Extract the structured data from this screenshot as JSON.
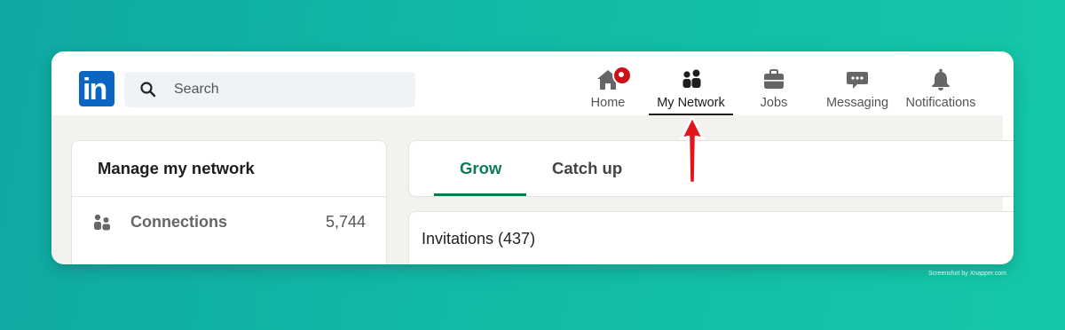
{
  "logo": {
    "text": "in",
    "color": "#0a66c2"
  },
  "search": {
    "placeholder": "Search",
    "icon": "search-icon"
  },
  "nav": {
    "items": [
      {
        "label": "Home",
        "icon": "home-icon",
        "has_badge": true
      },
      {
        "label": "My Network",
        "icon": "my-network-icon",
        "active": true
      },
      {
        "label": "Jobs",
        "icon": "briefcase-icon"
      },
      {
        "label": "Messaging",
        "icon": "chat-icon"
      },
      {
        "label": "Notifications",
        "icon": "bell-icon"
      }
    ]
  },
  "left_panel": {
    "title": "Manage my network",
    "rows": [
      {
        "label": "Connections",
        "count": "5,744",
        "icon": "connections-icon"
      }
    ]
  },
  "tabs": [
    {
      "label": "Grow",
      "active": true
    },
    {
      "label": "Catch up"
    }
  ],
  "invitations": {
    "title": "Invitations (437)"
  },
  "annotation": {
    "arrow_color": "#e4141b"
  },
  "credit": "Screenshot by Xnapper.com",
  "colors": {
    "accent_green": "#0e7a53",
    "badge_red": "#cc1016",
    "page_bg": "#f4f2ee"
  }
}
